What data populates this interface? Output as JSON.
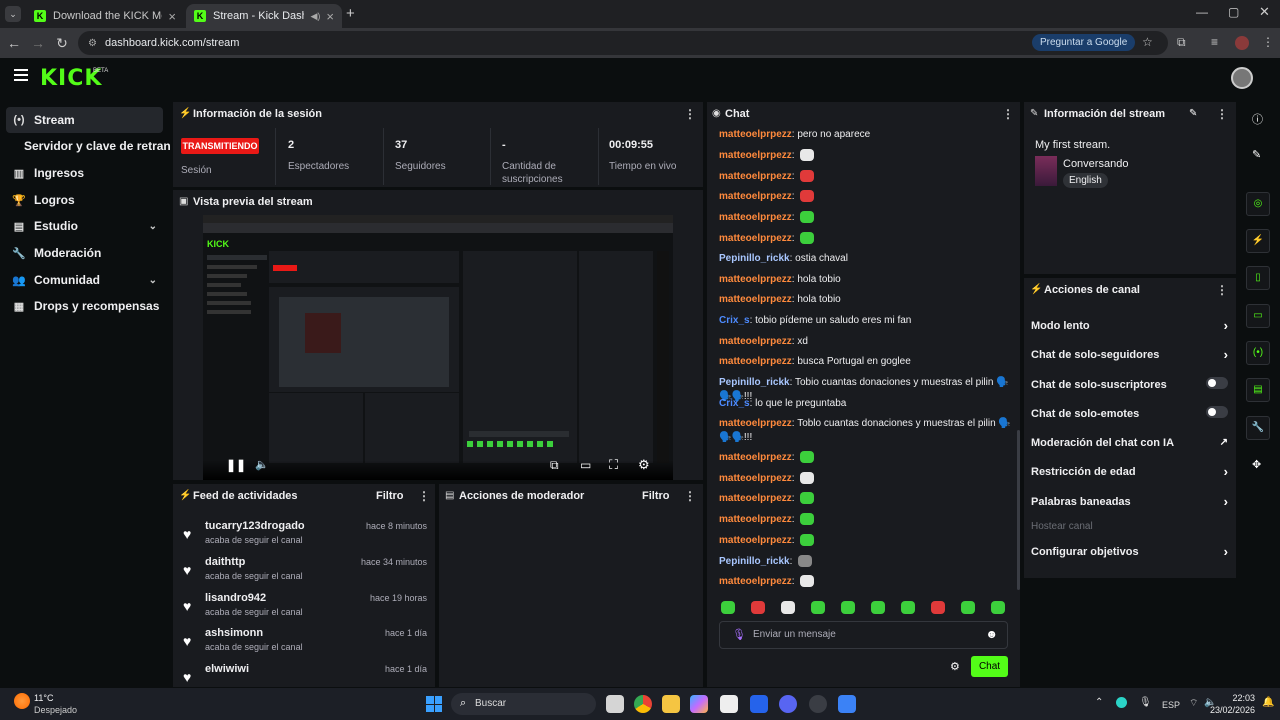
{
  "browser": {
    "tabs": [
      {
        "title": "Download the KICK Mobile & T",
        "active": false
      },
      {
        "title": "Stream - Kick Dashboard",
        "active": true
      }
    ],
    "url": "dashboard.kick.com/stream",
    "google_button": "Preguntar a Google"
  },
  "header": {
    "logo": "KICK",
    "beta": "BETA"
  },
  "sidebar": {
    "items": [
      {
        "label": "Stream",
        "icon": "broadcast-icon"
      },
      {
        "label": "Servidor y clave de retransm",
        "icon": ""
      },
      {
        "label": "Ingresos",
        "icon": "chart-icon"
      },
      {
        "label": "Logros",
        "icon": "trophy-icon"
      },
      {
        "label": "Estudio",
        "icon": "studio-icon"
      },
      {
        "label": "Moderación",
        "icon": "wrench-icon"
      },
      {
        "label": "Comunidad",
        "icon": "people-icon"
      },
      {
        "label": "Drops y recompensas",
        "icon": "gift-icon"
      }
    ]
  },
  "session": {
    "title": "Información de la sesión",
    "badge": "TRANSMITIENDO",
    "badge_label": "Sesión",
    "stats": [
      {
        "value": "2",
        "label": "Espectadores"
      },
      {
        "value": "37",
        "label": "Seguidores"
      },
      {
        "value": "-",
        "label": "Cantidad de suscripciones"
      },
      {
        "value": "00:09:55",
        "label": "Tiempo en vivo"
      }
    ]
  },
  "preview": {
    "title": "Vista previa del stream"
  },
  "feed": {
    "title": "Feed de actividades",
    "filter": "Filtro",
    "items": [
      {
        "name": "tucarry123drogado",
        "time": "hace 8 minutos",
        "sub": "acaba de seguir el canal"
      },
      {
        "name": "daithttp",
        "time": "hace 34 minutos",
        "sub": "acaba de seguir el canal"
      },
      {
        "name": "lisandro942",
        "time": "hace 19 horas",
        "sub": "acaba de seguir el canal"
      },
      {
        "name": "ashsimonn",
        "time": "hace 1 día",
        "sub": "acaba de seguir el canal"
      },
      {
        "name": "elwiwiwi",
        "time": "hace 1 día",
        "sub": ""
      }
    ]
  },
  "mod_actions": {
    "title": "Acciones de moderador",
    "filter": "Filtro"
  },
  "chat": {
    "title": "Chat",
    "messages": [
      {
        "user": "matteoelprpezz",
        "color": "#ff8a3d",
        "text": "pero no aparece",
        "emote": ""
      },
      {
        "user": "matteoelprpezz",
        "color": "#ff8a3d",
        "text": "",
        "emote": "#e8e8e8"
      },
      {
        "user": "matteoelprpezz",
        "color": "#ff8a3d",
        "text": "",
        "emote": "#e03a3a"
      },
      {
        "user": "matteoelprpezz",
        "color": "#ff8a3d",
        "text": "",
        "emote": "#e03a3a"
      },
      {
        "user": "matteoelprpezz",
        "color": "#ff8a3d",
        "text": "",
        "emote": "#3ccf3c"
      },
      {
        "user": "matteoelprpezz",
        "color": "#ff8a3d",
        "text": "",
        "emote": "#3ccf3c"
      },
      {
        "user": "Pepinillo_rickk",
        "color": "#a9c7ff",
        "text": "ostia chaval",
        "emote": ""
      },
      {
        "user": "matteoelprpezz",
        "color": "#ff8a3d",
        "text": "hola tobio",
        "emote": ""
      },
      {
        "user": "matteoelprpezz",
        "color": "#ff8a3d",
        "text": "hola tobio",
        "emote": ""
      },
      {
        "user": "Crix_s",
        "color": "#4d8bff",
        "text": "tobio pídeme un saludo eres mi fan",
        "emote": ""
      },
      {
        "user": "matteoelprpezz",
        "color": "#ff8a3d",
        "text": "xd",
        "emote": ""
      },
      {
        "user": "matteoelprpezz",
        "color": "#ff8a3d",
        "text": "busca Portugal en goglee",
        "emote": ""
      },
      {
        "user": "Pepinillo_rickk",
        "color": "#a9c7ff",
        "text": "Tobio cuantas donaciones y muestras el pilin 🗣️🗣️🗣️!!!",
        "emote": ""
      },
      {
        "user": "Crix_s",
        "color": "#4d8bff",
        "text": "lo que le preguntaba",
        "emote": ""
      },
      {
        "user": "matteoelprpezz",
        "color": "#ff8a3d",
        "text": "Toblo cuantas donaciones y muestras el pilin 🗣️🗣️🗣️!!!",
        "emote": ""
      },
      {
        "user": "matteoelprpezz",
        "color": "#ff8a3d",
        "text": "",
        "emote": "#3ccf3c"
      },
      {
        "user": "matteoelprpezz",
        "color": "#ff8a3d",
        "text": "",
        "emote": "#e8e8e8"
      },
      {
        "user": "matteoelprpezz",
        "color": "#ff8a3d",
        "text": "",
        "emote": "#3ccf3c"
      },
      {
        "user": "matteoelprpezz",
        "color": "#ff8a3d",
        "text": "",
        "emote": "#3ccf3c"
      },
      {
        "user": "matteoelprpezz",
        "color": "#ff8a3d",
        "text": "",
        "emote": "#3ccf3c"
      },
      {
        "user": "Pepinillo_rickk",
        "color": "#a9c7ff",
        "text": "",
        "emote": "#888888"
      },
      {
        "user": "matteoelprpezz",
        "color": "#ff8a3d",
        "text": "",
        "emote": "#e8e8e8"
      }
    ],
    "emote_bar": [
      "#3ccf3c",
      "#e03a3a",
      "#e8e8e8",
      "#3ccf3c",
      "#3ccf3c",
      "#3ccf3c",
      "#3ccf3c",
      "#e03a3a",
      "#3ccf3c",
      "#3ccf3c"
    ],
    "input_placeholder": "Enviar un mensaje",
    "send_button": "Chat"
  },
  "stream_info": {
    "title": "Información del stream",
    "stream_title": "My first stream.",
    "category": "Conversando",
    "language": "English"
  },
  "channel_actions": {
    "title": "Acciones de canal",
    "items": [
      {
        "label": "Modo lento",
        "control": "chevron",
        "disabled": false
      },
      {
        "label": "Chat de solo-seguidores",
        "control": "chevron",
        "disabled": false
      },
      {
        "label": "Chat de solo-suscriptores",
        "control": "toggle",
        "disabled": false
      },
      {
        "label": "Chat de solo-emotes",
        "control": "toggle",
        "disabled": false
      },
      {
        "label": "Moderación del chat con IA",
        "control": "external",
        "disabled": false
      },
      {
        "label": "Restricción de edad",
        "control": "chevron",
        "disabled": false
      },
      {
        "label": "Palabras baneadas",
        "control": "chevron",
        "disabled": false
      },
      {
        "label": "Hostear canal",
        "control": "",
        "disabled": true
      },
      {
        "label": "Configurar objetivos",
        "control": "chevron",
        "disabled": false
      }
    ]
  },
  "taskbar": {
    "weather_temp": "11°C",
    "weather_desc": "Despejado",
    "search": "Buscar",
    "lang": "ESP",
    "time": "22:03",
    "date": "23/02/2026"
  },
  "colors": {
    "accent": "#53fc18",
    "live": "#e91916",
    "panel": "#191b1f"
  }
}
